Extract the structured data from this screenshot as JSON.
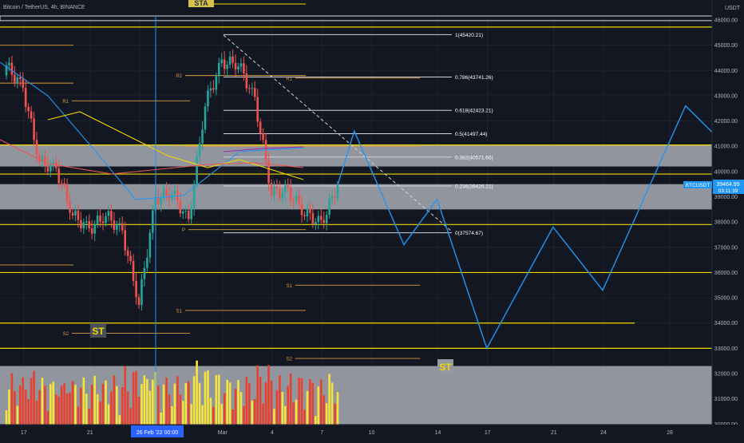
{
  "header": {
    "title": "Bitcoin / TetherUS, 4h, BINANCE",
    "badge": "STA"
  },
  "price_axis": {
    "currency": "USDT",
    "ticks": [
      "46000.00",
      "45000.00",
      "44000.00",
      "43000.00",
      "42000.00",
      "41000.00",
      "40000.00",
      "39000.00",
      "38000.00",
      "37000.00",
      "36000.00",
      "35000.00",
      "34000.00",
      "33000.00",
      "32000.00",
      "31000.00",
      "30000.00"
    ]
  },
  "time_axis": {
    "ticks": [
      "17",
      "21",
      "24",
      "Mar",
      "4",
      "7",
      "10",
      "14",
      "17",
      "21",
      "24",
      "28"
    ],
    "cursor_label": "26 Feb '22  00:00"
  },
  "last_price": {
    "symbol": "BTCUSDT",
    "price": "39464.99",
    "countdown": "03:11:39"
  },
  "fib_labels": [
    "1(45420.21)",
    "0.786(43741.26)",
    "0.618(42423.21)",
    "0.5(41497.44)",
    "0.382(40571.66)",
    "0.236(39426.21)",
    "0(37574.67)"
  ],
  "pivot_labels": [
    "R2",
    "R1",
    "R1",
    "R1",
    "P",
    "S1",
    "S1",
    "S1",
    "S2",
    "S2"
  ],
  "annotations": [
    "ST",
    "ST"
  ],
  "colors": {
    "background": "#131722",
    "grid": "#1e222d",
    "up": "#26a69a",
    "down": "#ef5350",
    "volume_up": "#f5e43b",
    "volume_down": "#e8402f",
    "level_line": "#f0d800",
    "projection": "#2196f3",
    "zone": "#b2b5be",
    "pivot": "#e09a3a"
  },
  "chart_data": {
    "type": "candlestick",
    "title": "Bitcoin / TetherUS, 4h, BINANCE",
    "y_range": [
      30000,
      46500
    ],
    "x_range": [
      "2022-02-16",
      "2022-03-31"
    ],
    "horizontal_levels": [
      45720,
      41050,
      39900,
      37900,
      36000,
      34000,
      33000
    ],
    "shaded_zones": [
      [
        40200,
        41050
      ],
      [
        38500,
        39500
      ],
      [
        30000,
        32300
      ]
    ],
    "fibonacci": [
      {
        "level": 1,
        "price": 45420.21
      },
      {
        "level": 0.786,
        "price": 43741.26
      },
      {
        "level": 0.618,
        "price": 42423.21
      },
      {
        "level": 0.5,
        "price": 41497.44
      },
      {
        "level": 0.382,
        "price": 40571.66
      },
      {
        "level": 0.236,
        "price": 39426.21
      },
      {
        "level": 0,
        "price": 37574.67
      }
    ],
    "price_path": [
      {
        "date": "2022-02-16",
        "close": 44200
      },
      {
        "date": "2022-02-17",
        "close": 43300
      },
      {
        "date": "2022-02-18",
        "close": 40400
      },
      {
        "date": "2022-02-19",
        "close": 40100
      },
      {
        "date": "2022-02-20",
        "close": 38300
      },
      {
        "date": "2022-02-21",
        "close": 37700
      },
      {
        "date": "2022-02-22",
        "close": 38300
      },
      {
        "date": "2022-02-23",
        "close": 37600
      },
      {
        "date": "2022-02-24",
        "close": 34800
      },
      {
        "date": "2022-02-25",
        "close": 38900
      },
      {
        "date": "2022-02-26",
        "close": 39200
      },
      {
        "date": "2022-02-27",
        "close": 38000
      },
      {
        "date": "2022-02-28",
        "close": 42700
      },
      {
        "date": "2022-03-01",
        "close": 44300
      },
      {
        "date": "2022-03-02",
        "close": 44300
      },
      {
        "date": "2022-03-03",
        "close": 42800
      },
      {
        "date": "2022-03-04",
        "close": 39200
      },
      {
        "date": "2022-03-05",
        "close": 39200
      },
      {
        "date": "2022-03-06",
        "close": 38400
      },
      {
        "date": "2022-03-07",
        "close": 37900
      },
      {
        "date": "2022-03-08",
        "close": 39465
      }
    ],
    "projection": [
      {
        "date": "2022-03-08",
        "price": 39465
      },
      {
        "date": "2022-03-09",
        "price": 41600
      },
      {
        "date": "2022-03-12",
        "price": 37100
      },
      {
        "date": "2022-03-14",
        "price": 38900
      },
      {
        "date": "2022-03-17",
        "price": 33000
      },
      {
        "date": "2022-03-21",
        "price": 37800
      },
      {
        "date": "2022-03-24",
        "price": 35300
      },
      {
        "date": "2022-03-29",
        "price": 42600
      },
      {
        "date": "2022-03-31",
        "price": 41300
      }
    ]
  }
}
